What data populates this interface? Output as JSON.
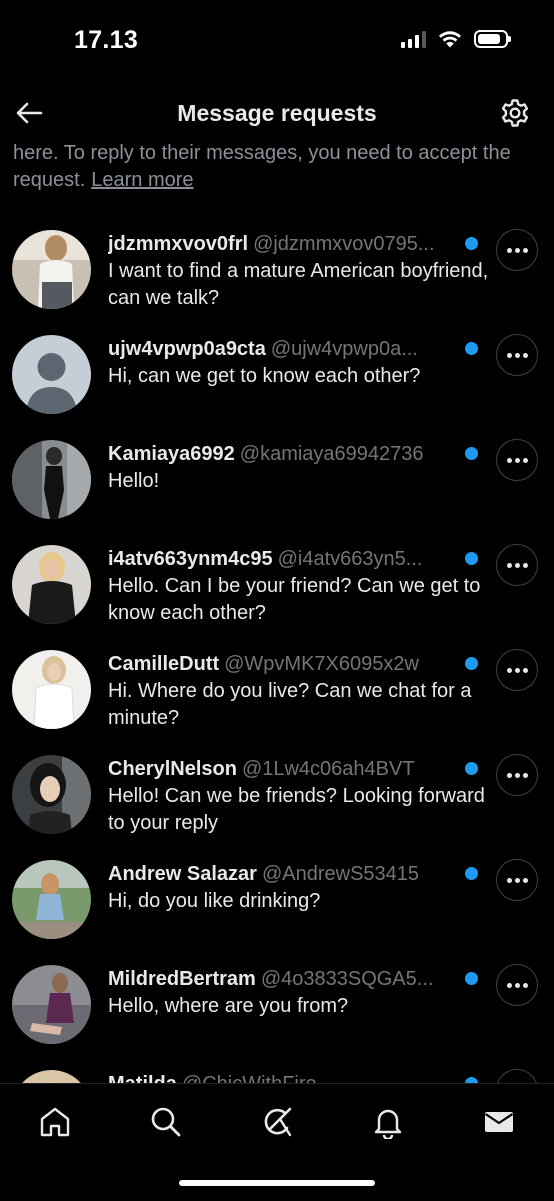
{
  "status_bar": {
    "time": "17.13",
    "battery_level": 0.85
  },
  "header": {
    "title": "Message requests",
    "back_icon": "arrow-left-icon",
    "settings_icon": "gear-icon"
  },
  "intro": {
    "text": "here. To reply to their messages, you need to accept the request.",
    "link": "Learn more"
  },
  "requests": [
    {
      "name": "jdzmmxvov0frl",
      "handle": "@jdzmmxvov0795...",
      "message": "I want to find a mature American boyfriend, can we talk?",
      "unread": true
    },
    {
      "name": "ujw4vpwp0a9cta",
      "handle": "@ujw4vpwp0a...",
      "message": "Hi, can we get to know each other?",
      "unread": true
    },
    {
      "name": "Kamiaya6992",
      "handle": "@kamiaya69942736",
      "message": "Hello!",
      "unread": true
    },
    {
      "name": "i4atv663ynm4c95",
      "handle": "@i4atv663yn5...",
      "message": "Hello. Can I be your friend? Can we get to know each other?",
      "unread": true
    },
    {
      "name": "CamilleDutt",
      "handle": "@WpvMK7X6095x2w",
      "message": "Hi. Where do you live? Can we chat for a minute?",
      "unread": true
    },
    {
      "name": "CherylNelson",
      "handle": "@1Lw4c06ah4BVT",
      "message": "Hello! Can we be friends? Looking forward to your reply",
      "unread": true
    },
    {
      "name": "Andrew Salazar",
      "handle": "@AndrewS53415",
      "message": "Hi, do you like drinking?",
      "unread": true
    },
    {
      "name": "MildredBertram",
      "handle": "@4o3833SQGA5...",
      "message": "Hello, where are you from?",
      "unread": true
    },
    {
      "name": "Matilda",
      "handle": "@ChicWithFire",
      "message": "",
      "unread": true
    }
  ],
  "bottom_nav": [
    {
      "icon": "home-icon",
      "label": "Home"
    },
    {
      "icon": "search-icon",
      "label": "Search"
    },
    {
      "icon": "grok-icon",
      "label": "Grok"
    },
    {
      "icon": "bell-icon",
      "label": "Notifications"
    },
    {
      "icon": "mail-icon",
      "label": "Messages"
    }
  ],
  "colors": {
    "background": "#000000",
    "text": "#e7e9ea",
    "secondary": "#71767b",
    "accent": "#1d9bf0"
  }
}
